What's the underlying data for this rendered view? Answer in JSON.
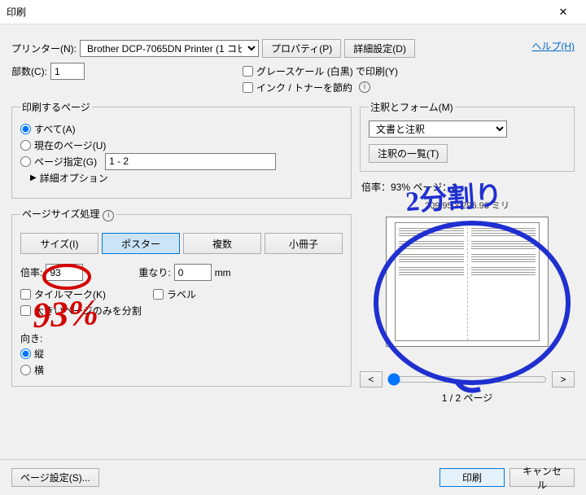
{
  "title": "印刷",
  "help": "ヘルプ(H)",
  "printer": {
    "label": "プリンター(N):",
    "value": "Brother DCP-7065DN Printer (1 コピー)",
    "properties": "プロパティ(P)",
    "advanced": "詳細設定(D)"
  },
  "copies": {
    "label": "部数(C):",
    "value": "1"
  },
  "options": {
    "grayscale": "グレースケール (白黒) で印刷(Y)",
    "save_ink": "インク / トナーを節約"
  },
  "range": {
    "legend": "印刷するページ",
    "all": "すべて(A)",
    "current": "現在のページ(U)",
    "pages": "ページ指定(G)",
    "pages_value": "1 - 2",
    "more": "詳細オプション"
  },
  "sizing": {
    "legend": "ページサイズ処理",
    "tabs": {
      "size": "サイズ(I)",
      "poster": "ポスター",
      "multiple": "複数",
      "booklet": "小冊子"
    },
    "scale_label": "倍率:",
    "scale_value": "93",
    "overlap_label": "重なり:",
    "overlap_value": "0",
    "overlap_unit": "mm",
    "tile_marks": "タイルマーク(K)",
    "labels": "ラベル",
    "large_only": "大きいページのみを分割"
  },
  "orient": {
    "label": "向き:",
    "portrait": "縦",
    "landscape": "横"
  },
  "right": {
    "forms_legend": "注釈とフォーム(M)",
    "forms_value": "文書と注釈",
    "annot_list": "注釈の一覧(T)",
    "scale_line": "倍率：93% ページ：2",
    "dim": "209.95 x 296.93 ミリ",
    "page_nav": "1 / 2 ページ",
    "prev": "<",
    "next": ">"
  },
  "footer": {
    "page_setup": "ページ設定(S)...",
    "print": "印刷",
    "cancel": "キャンセル"
  },
  "annotations": {
    "big_93": "93%",
    "split2": "2分割り"
  }
}
